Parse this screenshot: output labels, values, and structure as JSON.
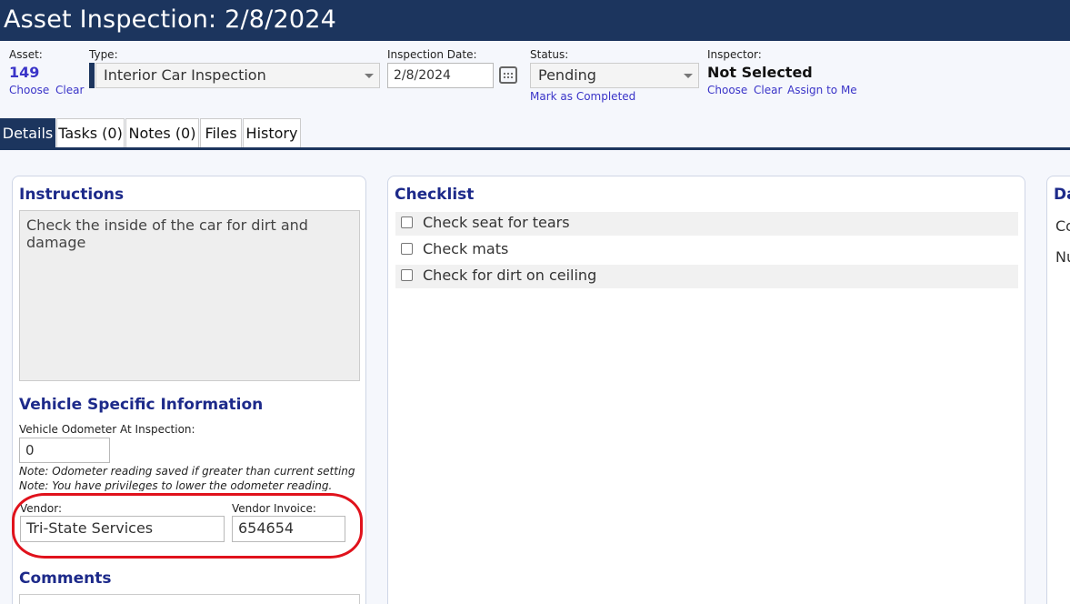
{
  "header": {
    "title": "Asset Inspection: 2/8/2024"
  },
  "asset": {
    "label": "Asset:",
    "value": "149",
    "choose": "Choose",
    "clear": "Clear"
  },
  "type": {
    "label": "Type:",
    "value": "Interior Car Inspection"
  },
  "inspection_date": {
    "label": "Inspection Date:",
    "value": "2/8/2024"
  },
  "status": {
    "label": "Status:",
    "value": "Pending",
    "mark_completed": "Mark as Completed"
  },
  "inspector": {
    "label": "Inspector:",
    "value": "Not Selected",
    "choose": "Choose",
    "clear": "Clear",
    "assign_to_me": "Assign to Me"
  },
  "tabs": [
    {
      "label": "Details",
      "active": true
    },
    {
      "label": "Tasks (0)"
    },
    {
      "label": "Notes (0)"
    },
    {
      "label": "Files"
    },
    {
      "label": "History"
    }
  ],
  "instructions": {
    "heading": "Instructions",
    "text": "Check the inside of the car for dirt and damage"
  },
  "vehicle": {
    "heading": "Vehicle Specific Information",
    "odometer_label": "Vehicle Odometer At Inspection:",
    "odometer_value": "0",
    "note1": "Note: Odometer reading saved if greater than current setting",
    "note2": "Note: You have privileges to lower the odometer reading.",
    "vendor_label": "Vendor:",
    "vendor_value": "Tri-State Services",
    "vendor_invoice_label": "Vendor Invoice:",
    "vendor_invoice_value": "654654"
  },
  "comments": {
    "heading": "Comments"
  },
  "checklist": {
    "heading": "Checklist",
    "items": [
      "Check seat for tears",
      "Check mats",
      "Check for dirt on ceiling"
    ]
  },
  "right_panel": {
    "heading_partial": "Da",
    "row1_partial": "Co",
    "row2_partial": "Nu"
  },
  "colors": {
    "header_bg": "#1c355e",
    "link": "#3a34c8",
    "heading": "#1d2a8a",
    "highlight": "#e0121c"
  }
}
